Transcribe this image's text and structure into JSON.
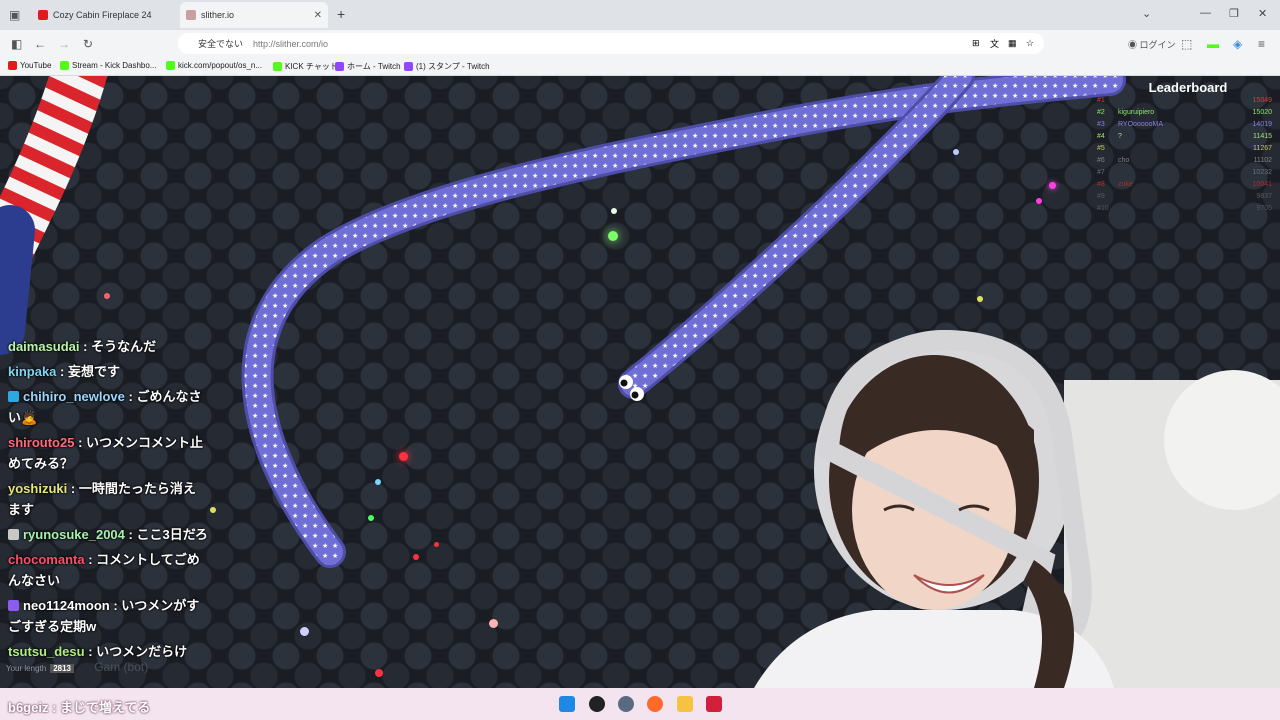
{
  "browser": {
    "tabs": [
      {
        "title": "Cozy Cabin Fireplace 24"
      },
      {
        "title": "slither.io"
      }
    ],
    "security_label": "安全でない",
    "url": "http://slither.com/io",
    "login_label": "ログイン",
    "bookmarks": [
      {
        "label": "YouTube",
        "color": "#e01b1b"
      },
      {
        "label": "Stream - Kick Dashbo...",
        "color": "#53fc18"
      },
      {
        "label": "kick.com/popout/os_n...",
        "color": "#53fc18"
      },
      {
        "label": "KICK チャット",
        "color": "#53fc18"
      },
      {
        "label": "ホーム - Twitch",
        "color": "#9146ff"
      },
      {
        "label": "(1) スタンプ - Twitch",
        "color": "#9146ff"
      }
    ]
  },
  "leaderboard": {
    "title": "Leaderboard",
    "rows": [
      {
        "rank": "#1",
        "name": "",
        "score": "15049",
        "color": "#e03b3b"
      },
      {
        "rank": "#2",
        "name": "kiguruipiero",
        "score": "15020",
        "color": "#8be86a"
      },
      {
        "rank": "#3",
        "name": "RYOoooooMA",
        "score": "14019",
        "color": "#8a7fe0"
      },
      {
        "rank": "#4",
        "name": "?",
        "score": "11415",
        "color": "#a8e07a"
      },
      {
        "rank": "#5",
        "name": "",
        "score": "11267",
        "color": "#c8c860"
      },
      {
        "rank": "#6",
        "name": "cho",
        "score": "11102",
        "color": "#7a8090"
      },
      {
        "rank": "#7",
        "name": "",
        "score": "10232",
        "color": "#6a7080"
      },
      {
        "rank": "#8",
        "name": "zuke",
        "score": "10041",
        "color": "#a83030"
      },
      {
        "rank": "#9",
        "name": "",
        "score": "9837",
        "color": "#555a66"
      },
      {
        "rank": "#10",
        "name": "",
        "score": "9705",
        "color": "#505562"
      }
    ]
  },
  "chat": [
    {
      "user": "daimasudai",
      "text": "そうなんだ",
      "color": "#b9f3a8",
      "badge": ""
    },
    {
      "user": "kinpaka",
      "text": "妄想です",
      "color": "#7fd6f2",
      "badge": ""
    },
    {
      "user": "chihiro_newlove",
      "text": "ごめんなさい🙇",
      "color": "#9ad8ff",
      "badge": "#2ea8e0"
    },
    {
      "user": "shirouto25",
      "text": "いつメンコメント止めてみる？",
      "color": "#ff6b7a",
      "badge": ""
    },
    {
      "user": "yoshizuki",
      "text": "一時間たったら消えます",
      "color": "#e8e87a",
      "badge": ""
    },
    {
      "user": "ryunosuke_2004",
      "text": "ここ3日だろ",
      "color": "#a8f0b0",
      "badge": "#c8c8c8"
    },
    {
      "user": "chocomanta",
      "text": "コメントしてごめんなさい",
      "color": "#ff4f6a",
      "badge": ""
    },
    {
      "user": "neo1124moon",
      "text": "いつメンがすごすぎる定期w",
      "color": "#ffffff",
      "badge": "#8a5cf0"
    },
    {
      "user": "tsutsu_desu",
      "text": "いつメンだらけ",
      "color": "#b0f080",
      "badge": ""
    }
  ],
  "bottom_chat": {
    "user": "b6geiz",
    "text": "まじで増えてる"
  },
  "game": {
    "length_label": "Your length",
    "length_value": "2813",
    "ghost_text": "Gam (bot)"
  }
}
